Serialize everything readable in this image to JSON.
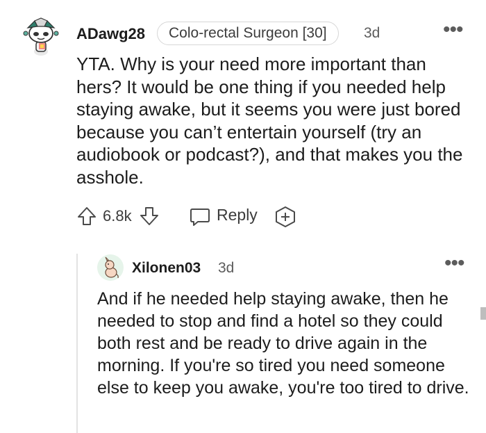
{
  "comment": {
    "username": "ADawg28",
    "flair": "Colo-rectal Surgeon [30]",
    "age": "3d",
    "more_label": "•••",
    "body": "YTA. Why is your need more important than hers? It would be one thing if you needed help staying awake, but it seems you were just bored because you can’t entertain yourself (try an audiobook or podcast?), and that makes you the asshole.",
    "vote_count": "6.8k",
    "reply_label": "Reply",
    "icons": [
      "upvote-icon",
      "downvote-icon",
      "reply-icon",
      "award-icon",
      "more-icon"
    ]
  },
  "reply": {
    "username": "Xilonen03",
    "age": "3d",
    "more_label": "•••",
    "body": "And if he needed help staying awake, then he needed to stop and find a hotel so they could both rest and be ready to drive again in the morning. If you're so tired you need someone else to keep you awake, you're too tired to drive."
  },
  "colors": {
    "text": "#1c1c1c",
    "meta": "#5c5c5c",
    "divider": "#e2e2e2",
    "reply_avatar_bg": "#e6f4ea"
  }
}
